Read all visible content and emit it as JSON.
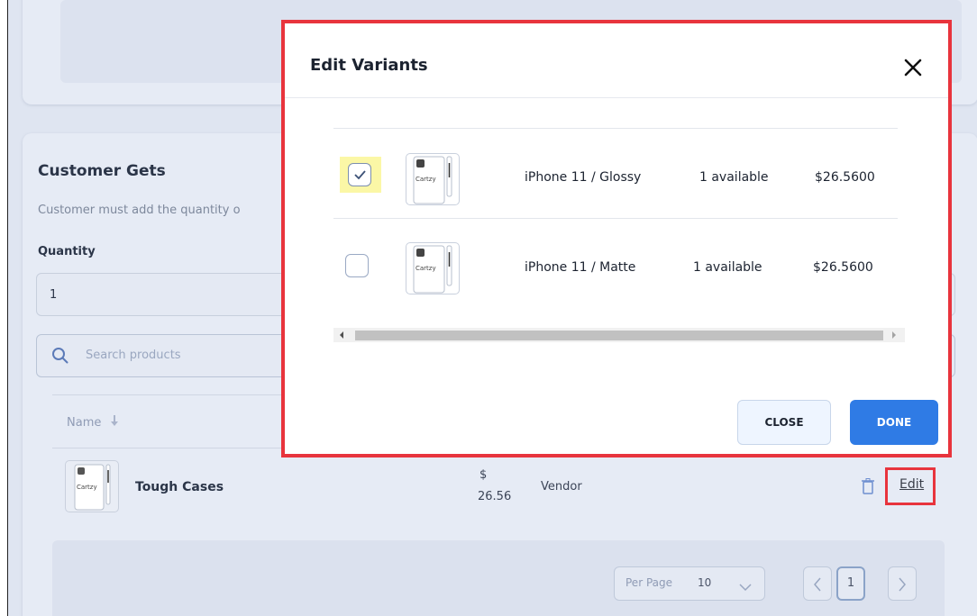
{
  "background": {
    "section_title": "Customer Gets",
    "section_desc": "Customer must add the quantity o",
    "quantity_label": "Quantity",
    "quantity_value": "1",
    "search_placeholder": "Search products",
    "table": {
      "column_name": "Name",
      "row": {
        "product_name": "Tough Cases",
        "price_symbol": "$",
        "price": "26.56",
        "vendor": "Vendor",
        "edit_label": "Edit"
      }
    },
    "pagination": {
      "per_page_label": "Per Page",
      "per_page_value": "10",
      "current_page": "1"
    }
  },
  "modal": {
    "title": "Edit Variants",
    "variants": [
      {
        "name": "iPhone 11 / Glossy",
        "availability": "1 available",
        "price": "$26.5600",
        "checked": true
      },
      {
        "name": "iPhone 11 / Matte",
        "availability": "1 available",
        "price": "$26.5600",
        "checked": false
      }
    ],
    "thumb_brand": "Cartzy",
    "close_label": "CLOSE",
    "done_label": "DONE"
  },
  "colors": {
    "accent": "#2f7be5",
    "highlight_border": "#e8343d",
    "checkbox_highlight": "#fbf7a6"
  }
}
